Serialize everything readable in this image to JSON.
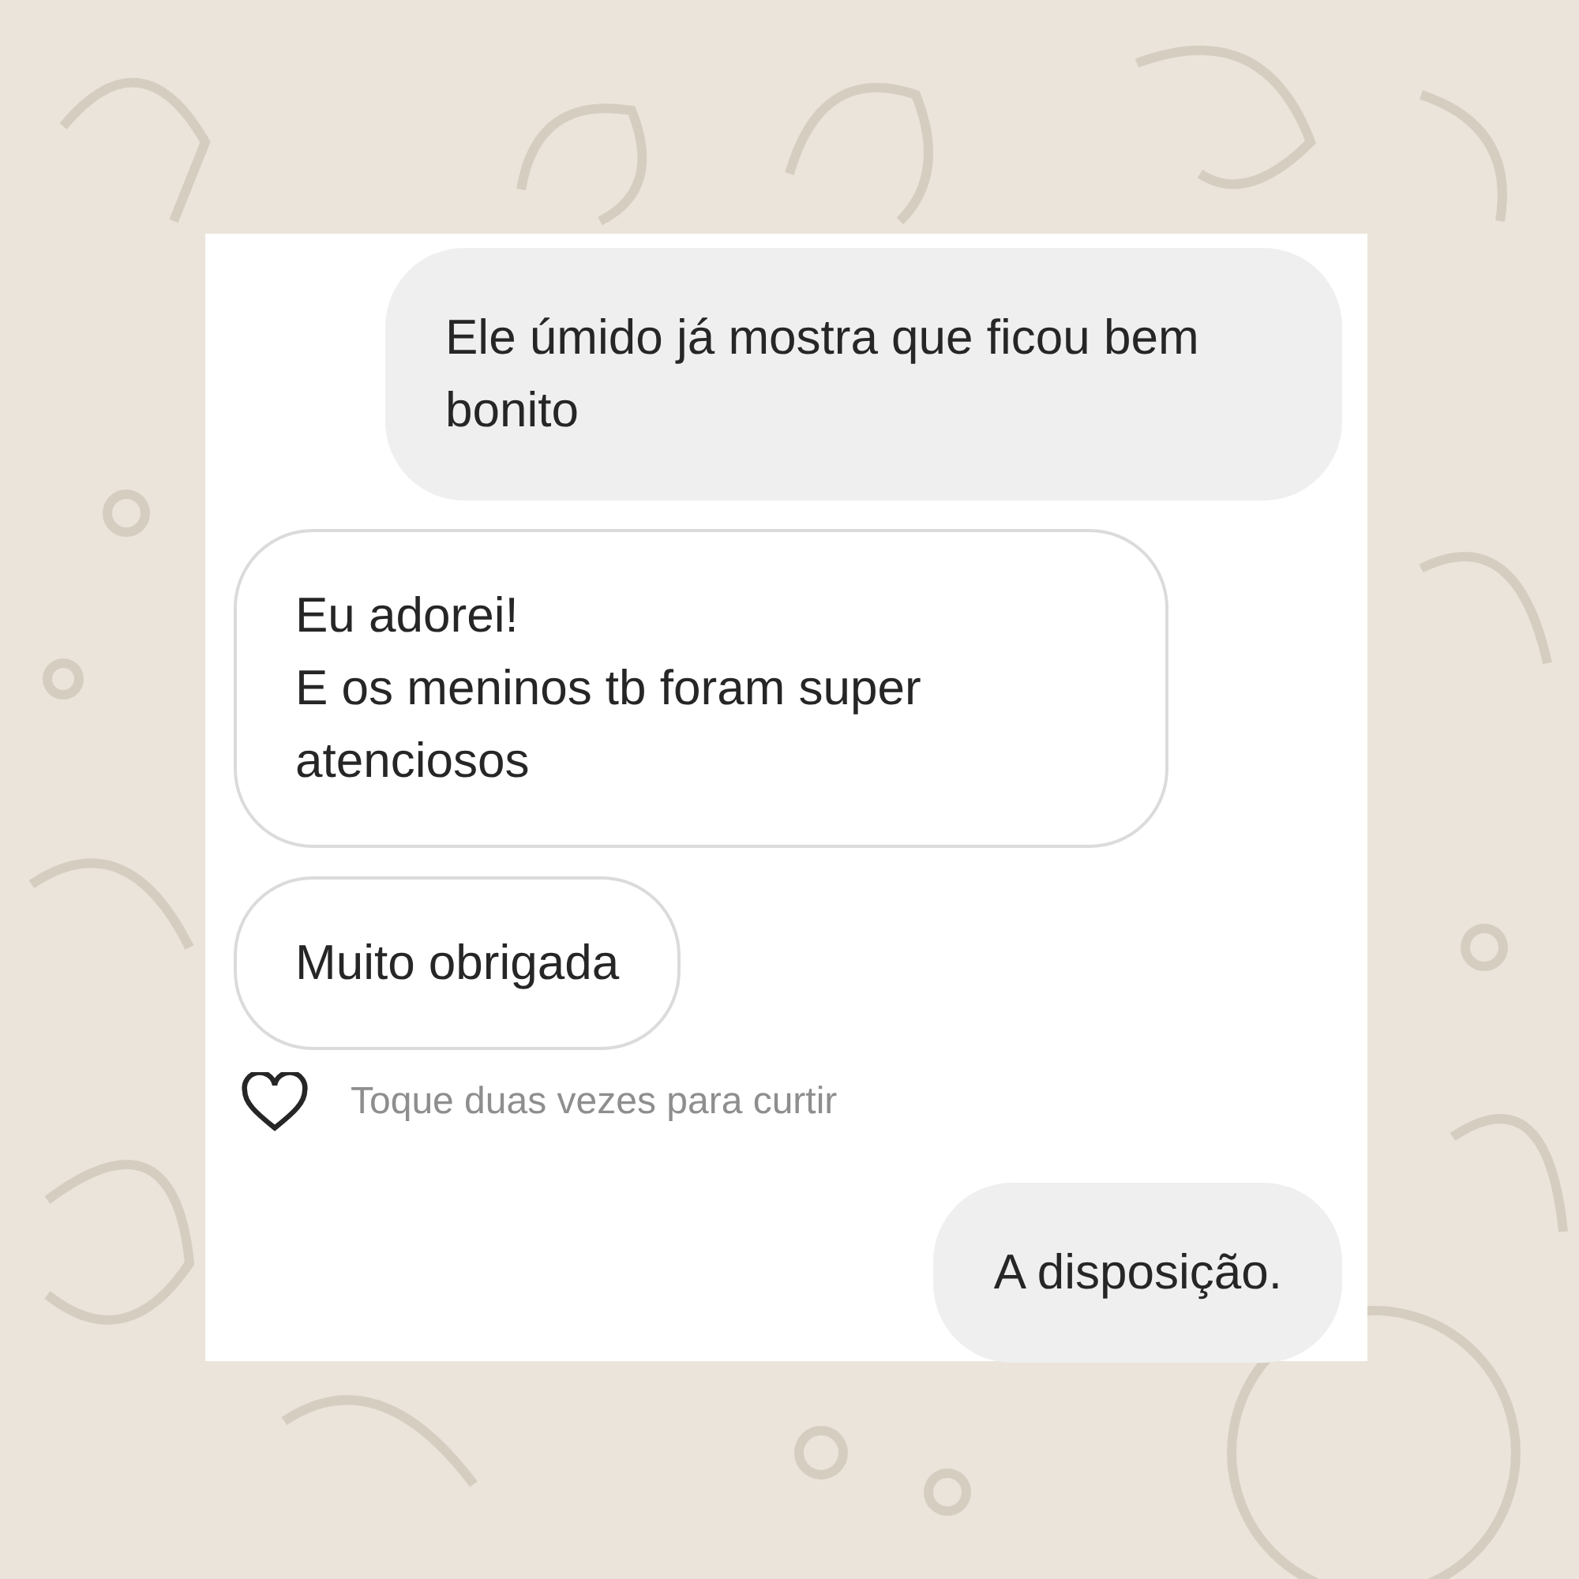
{
  "messages": [
    {
      "kind": "sent",
      "text": "Ele úmido já mostra que ficou bem bonito"
    },
    {
      "kind": "received",
      "text": "Eu adorei!\nE os meninos tb foram super atenciosos"
    },
    {
      "kind": "received",
      "text": "Muito obrigada"
    },
    {
      "kind": "like_hint",
      "text": "Toque duas vezes para curtir"
    },
    {
      "kind": "sent",
      "text": "A disposição."
    }
  ]
}
